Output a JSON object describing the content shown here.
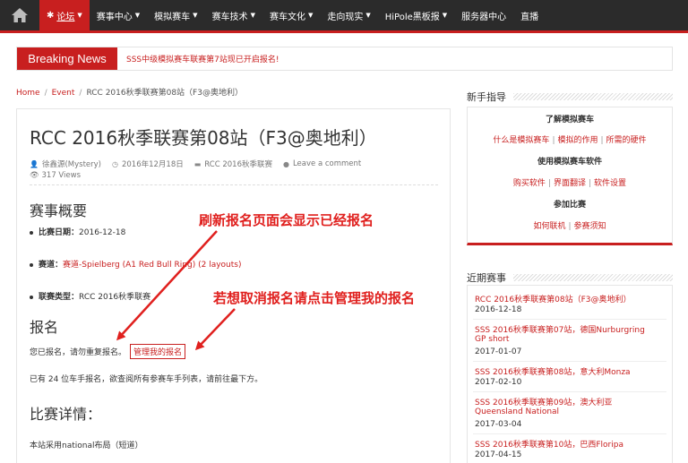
{
  "nav": {
    "items": [
      {
        "label": "论坛",
        "active": true
      },
      {
        "label": "赛事中心"
      },
      {
        "label": "模拟赛车"
      },
      {
        "label": "赛车技术"
      },
      {
        "label": "赛车文化"
      },
      {
        "label": "走向现实"
      },
      {
        "label": "HiPole黑板报"
      },
      {
        "label": "服务器中心"
      },
      {
        "label": "直播"
      }
    ]
  },
  "breaking": {
    "label": "Breaking News",
    "text": "SSS中级模拟赛车联赛第7站现已开启报名!"
  },
  "breadcrumb": {
    "home": "Home",
    "event": "Event",
    "current": "RCC 2016秋季联赛第08站（F3@奥地利）"
  },
  "article": {
    "title": "RCC 2016秋季联赛第08站（F3@奥地利）",
    "author": "徐鑫源(Mystery)",
    "date": "2016年12月18日",
    "category": "RCC 2016秋季联赛",
    "comment": "Leave a comment",
    "views": "317 Views",
    "overview_heading": "赛事概要",
    "race_date_label": "比赛日期：",
    "race_date_value": "2016-12-18",
    "track_label": "赛道：",
    "track_value": "赛道-Spielberg (A1 Red Bull Ring) (2 layouts)",
    "type_label": "联赛类型：",
    "type_value": "RCC 2016秋季联赛",
    "signup_heading": "报名",
    "signed_text": "您已报名，请勿重复报名。",
    "manage_label": "管理我的报名",
    "count_text": "已有 24 位车手报名，欲查阅所有参赛车手列表，请前往最下方。",
    "details_heading": "比赛详情：",
    "layout_text": "本站采用national布局（短道）"
  },
  "annotations": {
    "top": "刷新报名页面会显示已经报名",
    "bottom": "若想取消报名请点击管理我的报名"
  },
  "sidebar": {
    "guide_heading": "新手指导",
    "guide": {
      "h1": "了解模拟赛车",
      "links1": [
        "什么是模拟赛车",
        "模拟的作用",
        "所需的硬件"
      ],
      "h2": "使用模拟赛车软件",
      "links2": [
        "购买软件",
        "界面翻译",
        "软件设置"
      ],
      "h3": "参加比赛",
      "links3": [
        "如何联机",
        "参赛须知"
      ]
    },
    "events_heading": "近期赛事",
    "events": [
      {
        "title": "RCC 2016秋季联赛第08站（F3@奥地利）",
        "date": "2016-12-18"
      },
      {
        "title": "SSS 2016秋季联赛第07站，德国Nurburgring",
        "title2": "GP short",
        "date": "2017-01-07"
      },
      {
        "title": "SSS 2016秋季联赛第08站，意大利Monza",
        "date": "2017-02-10"
      },
      {
        "title": "SSS 2016秋季联赛第09站，澳大利亚",
        "title2": "Queensland National",
        "date": "2017-03-04"
      },
      {
        "title": "SSS 2016秋季联赛第10站，巴西Floripa",
        "date": "2017-04-15"
      }
    ]
  }
}
